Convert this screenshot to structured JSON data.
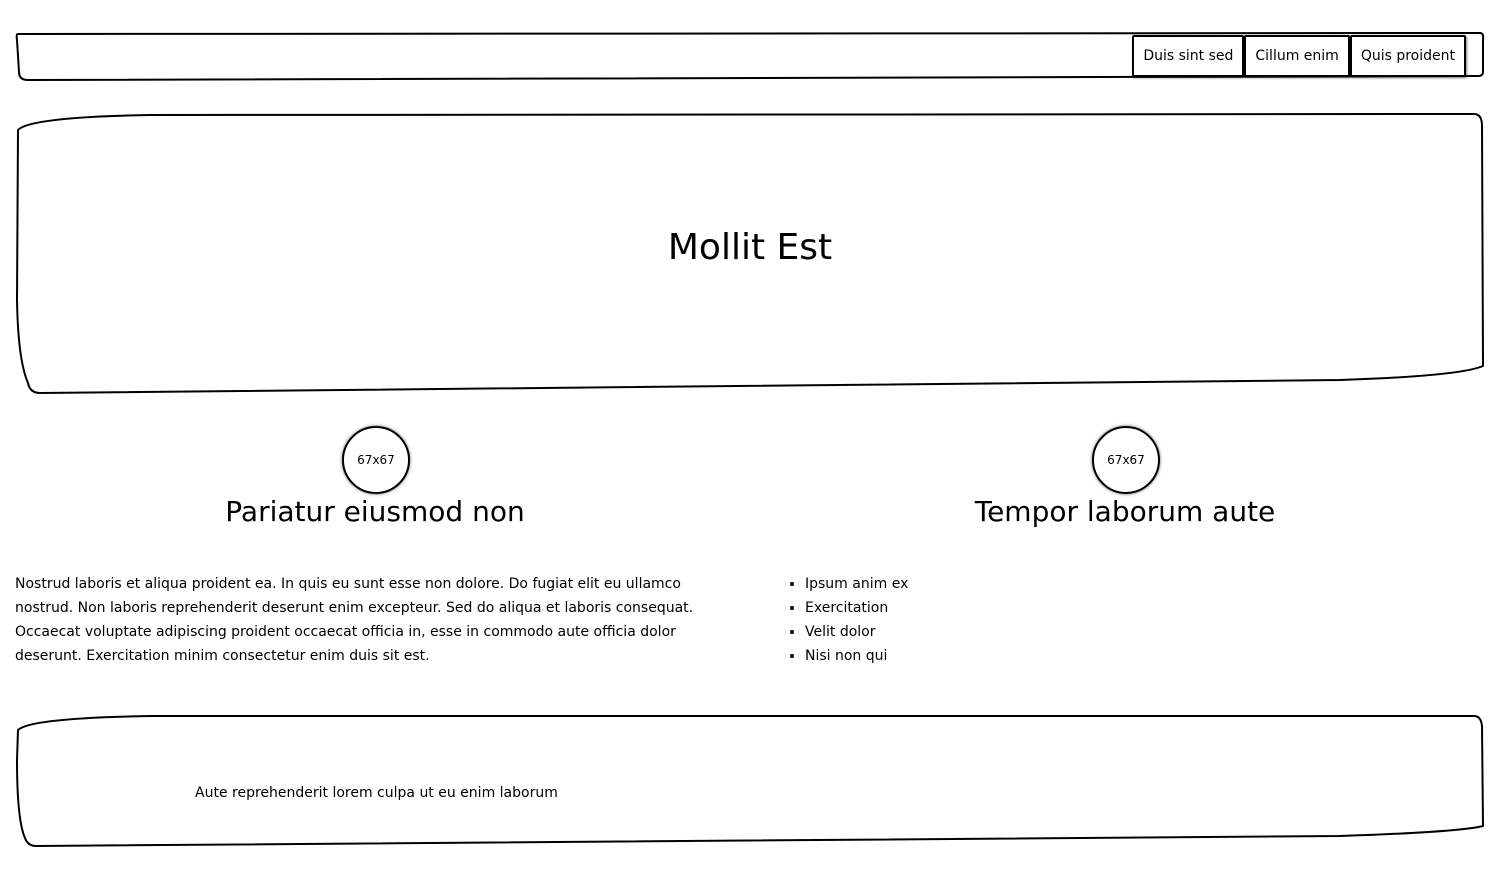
{
  "nav": {
    "items": [
      {
        "label": "Duis sint sed"
      },
      {
        "label": "Cillum enim"
      },
      {
        "label": "Quis proident"
      }
    ]
  },
  "hero": {
    "title": "Mollit Est"
  },
  "columns": [
    {
      "avatar_label": "67x67",
      "heading": "Pariatur eiusmod non",
      "body": "Nostrud laboris et aliqua proident ea. In quis eu sunt esse non dolore. Do fugiat elit eu ullamco nostrud. Non laboris reprehenderit deserunt enim excepteur. Sed do aliqua et laboris consequat. Occaecat voluptate adipiscing proident occaecat officia in, esse in commodo aute officia dolor deserunt. Exercitation minim consectetur enim duis sit est."
    },
    {
      "avatar_label": "67x67",
      "heading": "Tempor laborum aute",
      "list": [
        "Ipsum anim ex",
        "Exercitation",
        "Velit dolor",
        "Nisi non qui"
      ]
    }
  ],
  "footer": {
    "text": "Aute reprehenderit lorem culpa ut eu enim laborum"
  }
}
